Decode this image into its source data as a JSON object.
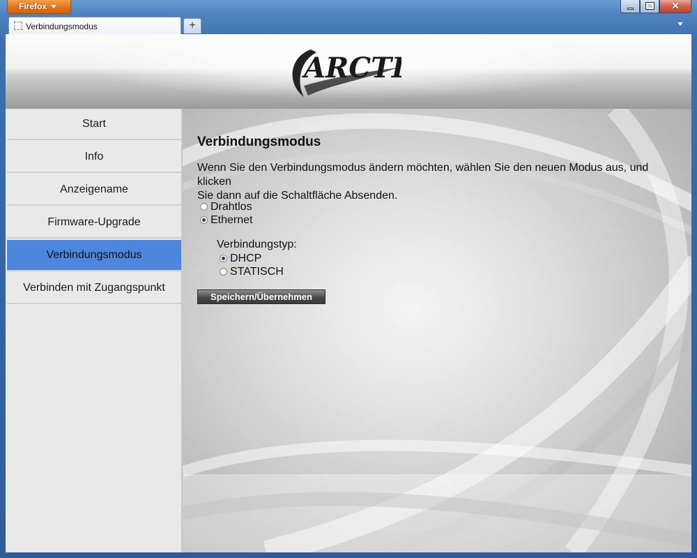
{
  "browser": {
    "app_button": "Firefox",
    "tab_title": "Verbindungsmodus",
    "new_tab_symbol": "+",
    "close_symbol": "✕"
  },
  "header": {
    "logo_text": "ARCTIC"
  },
  "sidebar": {
    "items": [
      {
        "label": "Start"
      },
      {
        "label": "Info"
      },
      {
        "label": "Anzeigename"
      },
      {
        "label": "Firmware-Upgrade"
      },
      {
        "label": "Verbindungsmodus",
        "active": true
      },
      {
        "label": "Verbinden mit Zugangspunkt"
      }
    ],
    "active_color": "#4c86dd"
  },
  "main": {
    "title": "Verbindungsmodus",
    "intro_line1": "Wenn Sie den Verbindungsmodus ändern möchten, wählen Sie den neuen Modus aus, und klicken",
    "intro_line2": "Sie dann auf die Schaltfläche Absenden.",
    "mode_options": [
      {
        "label": "Drahtlos",
        "checked": false
      },
      {
        "label": "Ethernet",
        "checked": true
      }
    ],
    "connection_type_label": "Verbindungstyp:",
    "type_options": [
      {
        "label": "DHCP",
        "checked": true
      },
      {
        "label": "STATISCH",
        "checked": false
      }
    ],
    "save_button": "Speichern/Übernehmen"
  }
}
